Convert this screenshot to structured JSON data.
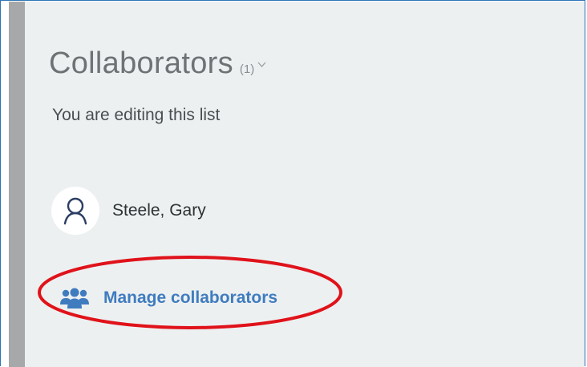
{
  "panel": {
    "title": "Collaborators",
    "count": "(1)",
    "subtitle": "You are editing this list"
  },
  "collaborators": [
    {
      "name": "Steele, Gary",
      "icon": "user-icon"
    }
  ],
  "actions": {
    "manage_label": "Manage collaborators",
    "manage_icon": "users-icon"
  },
  "annotation": {
    "color": "#e0121a",
    "shape": "ellipse"
  },
  "colors": {
    "panel_background": "#edf0f1",
    "side_bar": "#a6a8aa",
    "link": "#3f7cbf",
    "frame_border": "#2e75b6"
  }
}
